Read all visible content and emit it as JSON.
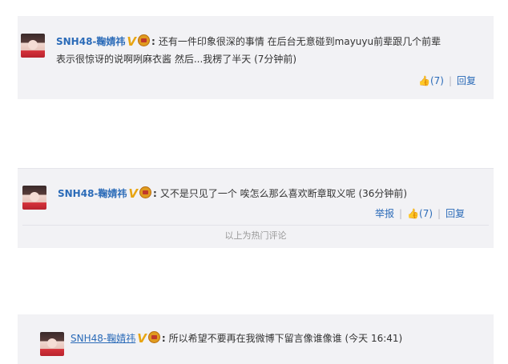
{
  "comments": [
    {
      "user": "SNH48-鞠婧祎",
      "text_line1": "还有一件印象很深的事情 在后台无意碰到mayuyu前辈跟几个前辈",
      "text_line2": "表示很惊讶的说啊咧麻衣酱 然后...我楞了半天 (7分钟前)",
      "like_count": "(7)",
      "reply_label": "回复"
    },
    {
      "user": "SNH48-鞠婧祎",
      "text": "又不是只见了一个 唉怎么那么喜欢断章取义呢 (36分钟前)",
      "report_label": "举报",
      "like_count": "(7)",
      "reply_label": "回复",
      "hot_footer": "以上为热门评论"
    },
    {
      "user": "SNH48-鞠婧祎",
      "text": "所以希望不要再在我微博下留言像谁像谁 (今天 16:41)"
    }
  ],
  "colors": {
    "link": "#2b6bb8",
    "card_bg": "#f2f2f5",
    "badge_gold": "#e8a512"
  },
  "icons": [
    "verified-v-icon",
    "crown-badge-icon",
    "thumb-up-icon",
    "avatar"
  ]
}
